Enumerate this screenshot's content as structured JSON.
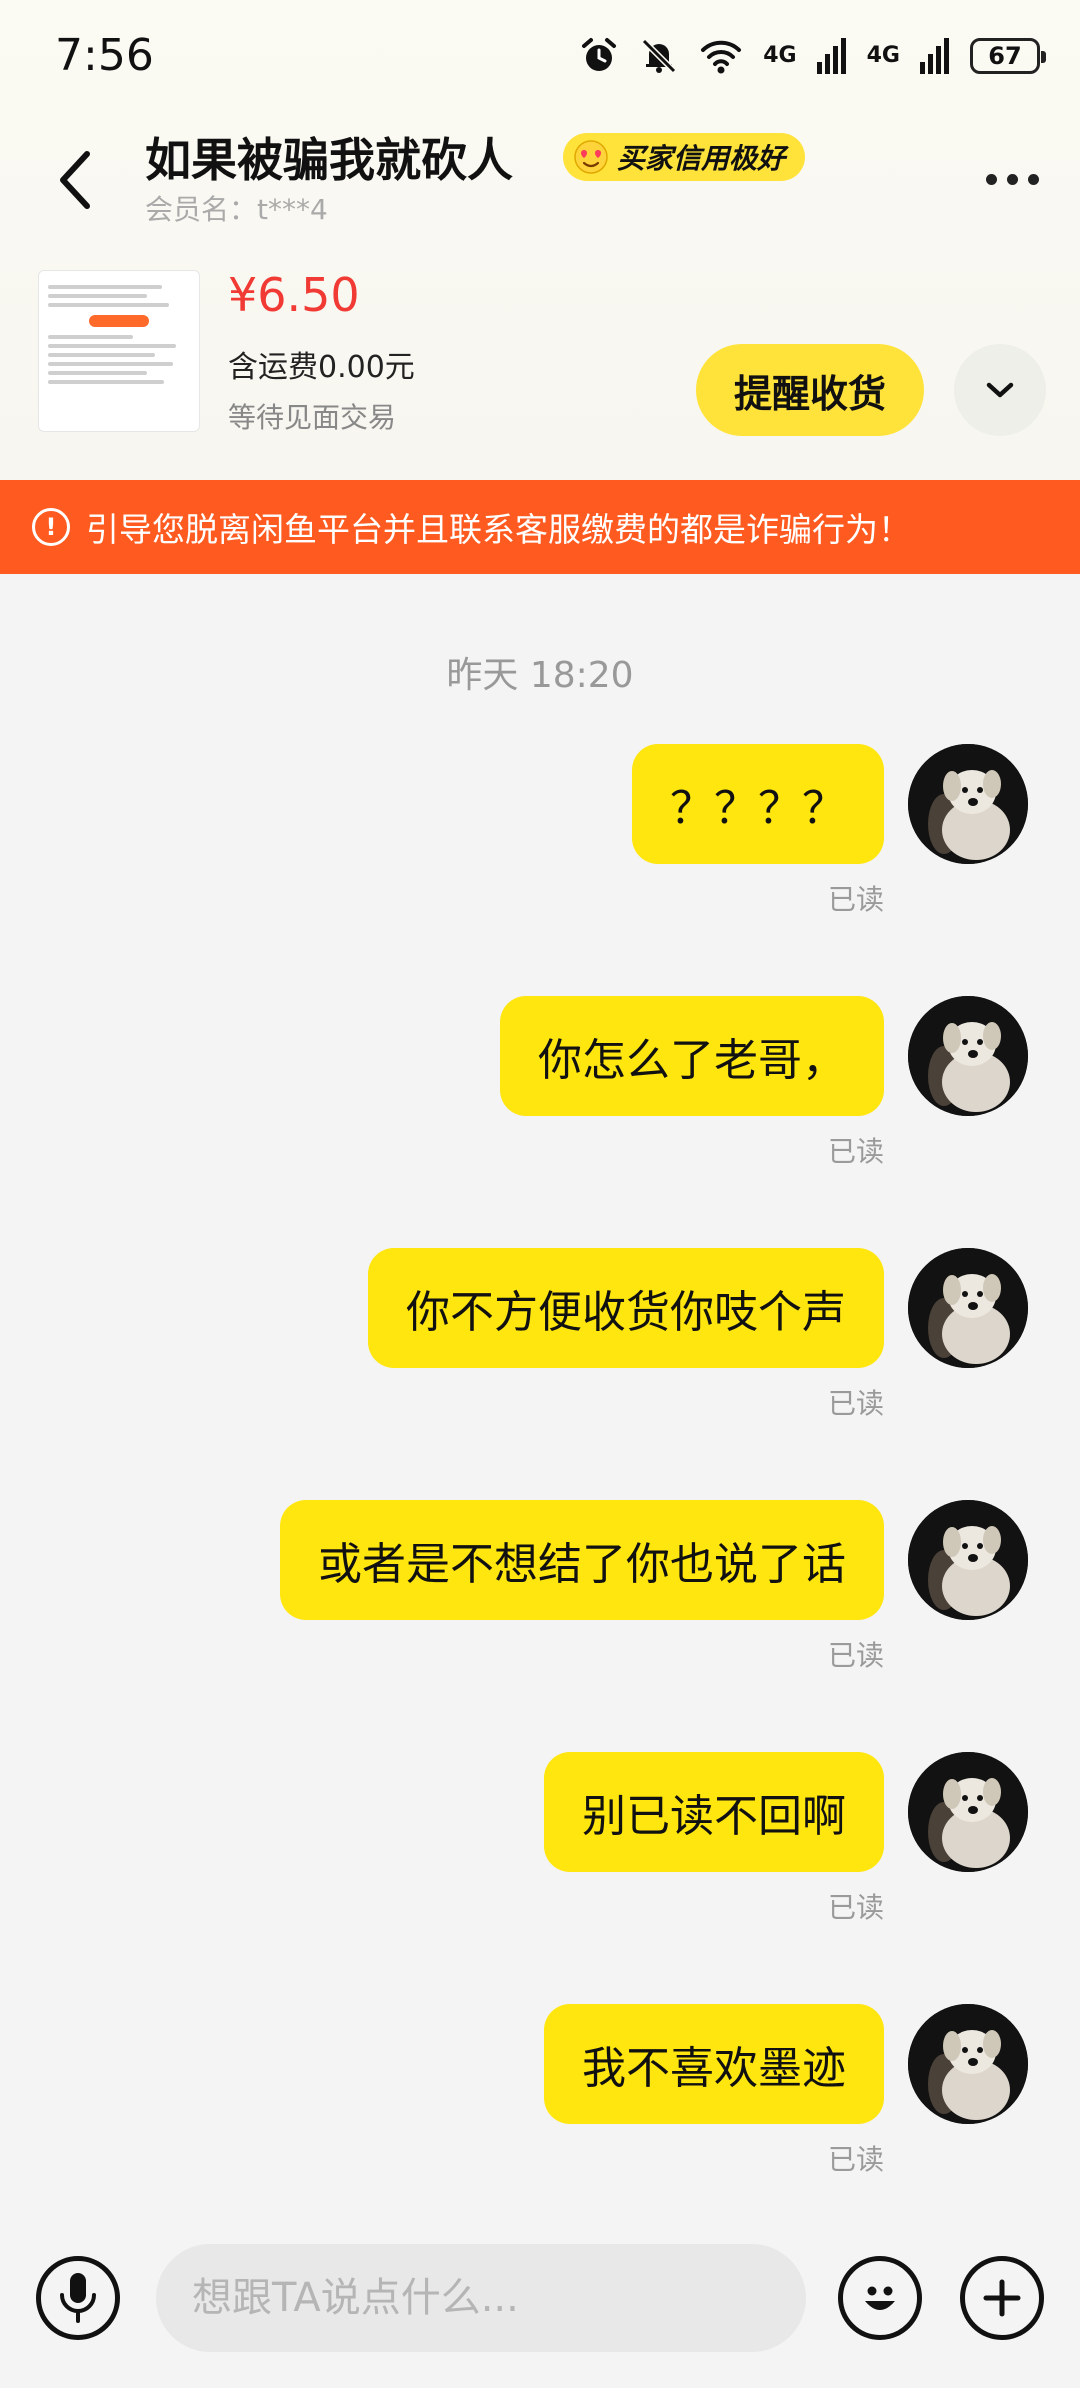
{
  "status_bar": {
    "time": "7:56",
    "network_1": "4G",
    "network_2": "4G",
    "battery": "67"
  },
  "header": {
    "name": "如果被骗我就砍人",
    "credit_badge": "买家信用极好",
    "member_label": "会员名：t***4"
  },
  "product": {
    "price": "¥6.50",
    "shipping": "含运费0.00元",
    "status": "等待见面交易",
    "remind_label": "提醒收货"
  },
  "warning": {
    "icon_text": "!",
    "text": "引导您脱离闲鱼平台并且联系客服缴费的都是诈骗行为！"
  },
  "chat": {
    "timestamp": "昨天 18:20",
    "read_label": "已读",
    "messages": [
      {
        "text": "？？？？",
        "status": "已读"
      },
      {
        "text": "你怎么了老哥，",
        "status": "已读"
      },
      {
        "text": "你不方便收货你吱个声",
        "status": "已读"
      },
      {
        "text": "或者是不想结了你也说了话",
        "status": "已读"
      },
      {
        "text": "别已读不回啊",
        "status": "已读"
      },
      {
        "text": "我不喜欢墨迹",
        "status": "已读"
      }
    ]
  },
  "input": {
    "placeholder": "想跟TA说点什么..."
  },
  "colors": {
    "accent_yellow": "#ffe60f",
    "warning_orange": "#ff5a1f",
    "price_red": "#f03a33"
  },
  "icons": [
    "alarm-icon",
    "mute-bell-icon",
    "wifi-icon",
    "signal-icon",
    "back-arrow-icon",
    "more-icon",
    "chevron-down-icon",
    "warning-icon",
    "microphone-icon",
    "emoji-icon",
    "plus-icon"
  ]
}
